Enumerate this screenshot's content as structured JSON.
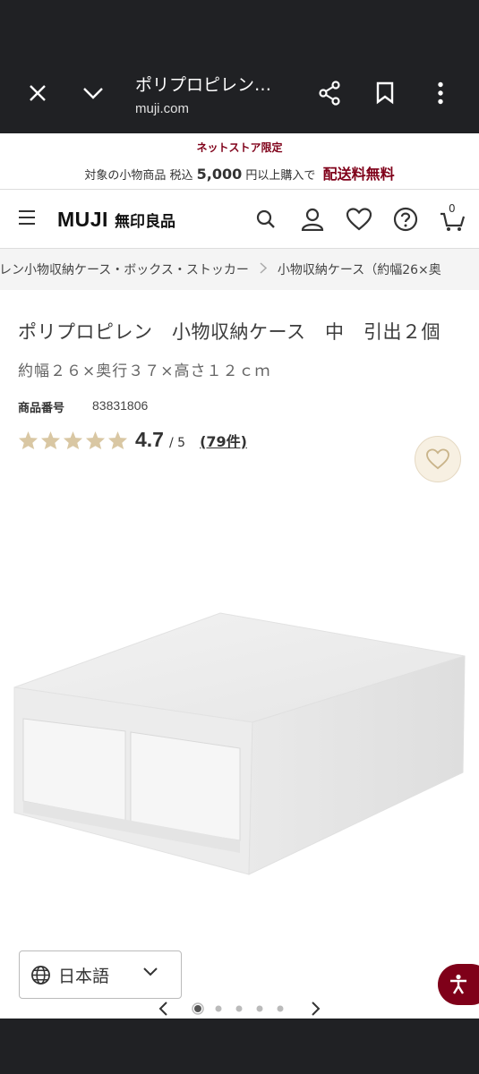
{
  "browser": {
    "page_title": "ポリプロピレン…",
    "url": "muji.com",
    "icons": [
      "close-icon",
      "chevron-down-icon",
      "share-icon",
      "bookmark-icon",
      "more-vert-icon"
    ]
  },
  "promo": {
    "headline": "ネットストア限定",
    "text_before": "対象の小物商品 税込",
    "amount": "5,000",
    "text_after": "円以上購入で",
    "free_shipping": "配送料無料"
  },
  "header": {
    "logo_en": "MUJI",
    "logo_jp": "無印良品",
    "cart_count": "0",
    "icons": [
      "menu-icon",
      "search-icon",
      "account-icon",
      "heart-icon",
      "help-icon",
      "cart-icon"
    ]
  },
  "breadcrumbs": [
    "レン小物収納ケース・ボックス・ストッカー",
    "小物収納ケース（約幅26×奥"
  ],
  "product": {
    "title": "ポリプロピレン　小物収納ケース　中　引出２個",
    "size": "約幅２６×奥行３７×高さ１２ｃｍ",
    "number_label": "商品番号",
    "number_value": "83831806",
    "rating": 4.7,
    "rating_text": "4.7",
    "rating_out_of": "/ 5",
    "review_count": "(79件)"
  },
  "gallery": {
    "current_index": 1,
    "total": 5
  },
  "language": {
    "selected": "日本語"
  },
  "colors": {
    "brand": "#7f0019",
    "star": "#d9c7a3",
    "chrome": "#202124"
  }
}
